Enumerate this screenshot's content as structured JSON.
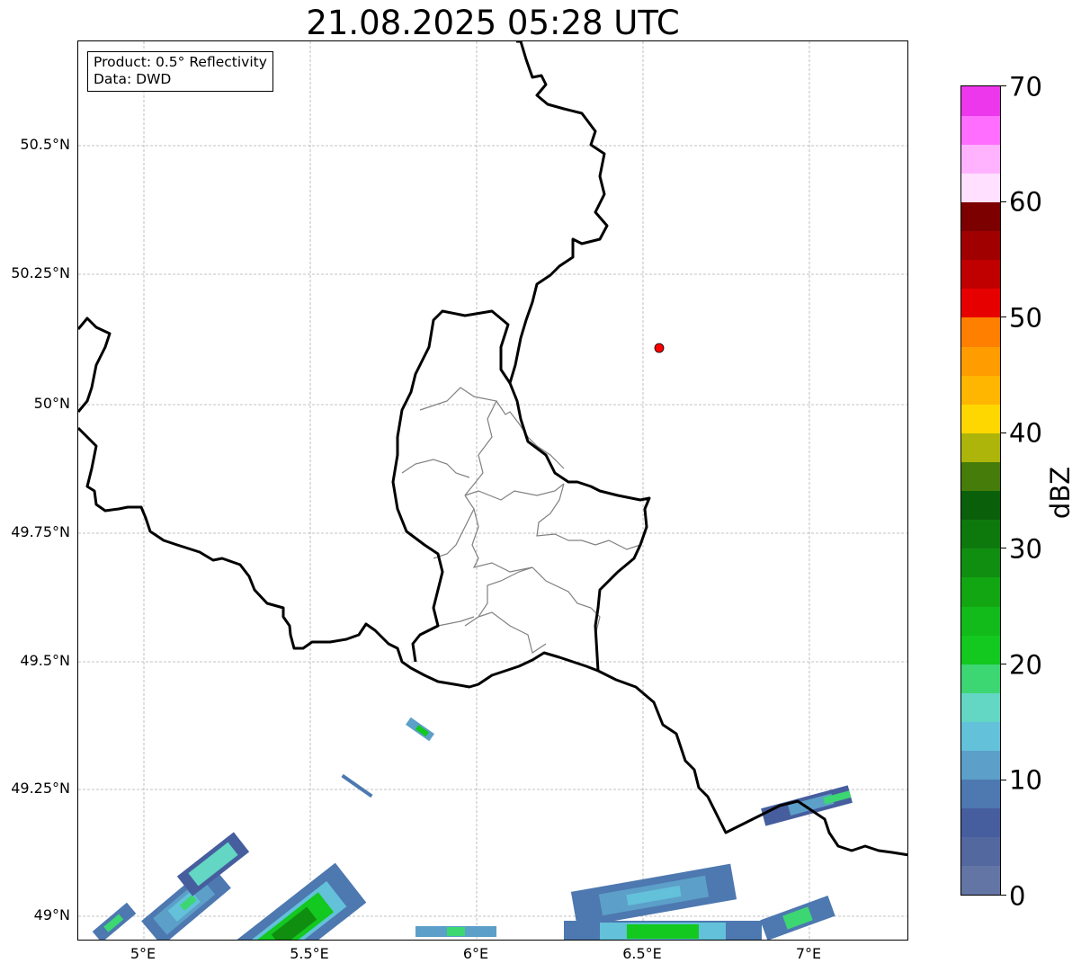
{
  "title": "21.08.2025 05:28 UTC",
  "info_box": {
    "line1": "Product: 0.5° Reflectivity",
    "line2": "Data: DWD"
  },
  "map": {
    "lat_labels": [
      "50.5°N",
      "50.25°N",
      "50°N",
      "49.75°N",
      "49.5°N",
      "49.25°N",
      "49°N"
    ],
    "lon_labels": [
      "5°E",
      "5.5°E",
      "6°E",
      "6.5°E",
      "7°E"
    ],
    "radar_site": {
      "lon": 6.55,
      "lat": 50.11,
      "color": "#ff0000"
    }
  },
  "colorbar": {
    "unit": "dBZ",
    "tick_labels": [
      "0",
      "10",
      "20",
      "30",
      "40",
      "50",
      "60",
      "70"
    ],
    "colors": [
      "#6375a4",
      "#5468a0",
      "#465e9e",
      "#4d78b0",
      "#5c9fc8",
      "#63c1da",
      "#63d6c4",
      "#3cd672",
      "#13c81e",
      "#12bb1a",
      "#11a612",
      "#108e10",
      "#0d790d",
      "#0a600a",
      "#457c0a",
      "#adb40a",
      "#ffd700",
      "#ffb600",
      "#ff9c00",
      "#ff7f00",
      "#e60000",
      "#c00000",
      "#a00000",
      "#7d0000",
      "#ffe0ff",
      "#ffb3ff",
      "#ff6eff",
      "#ec37ec"
    ]
  }
}
